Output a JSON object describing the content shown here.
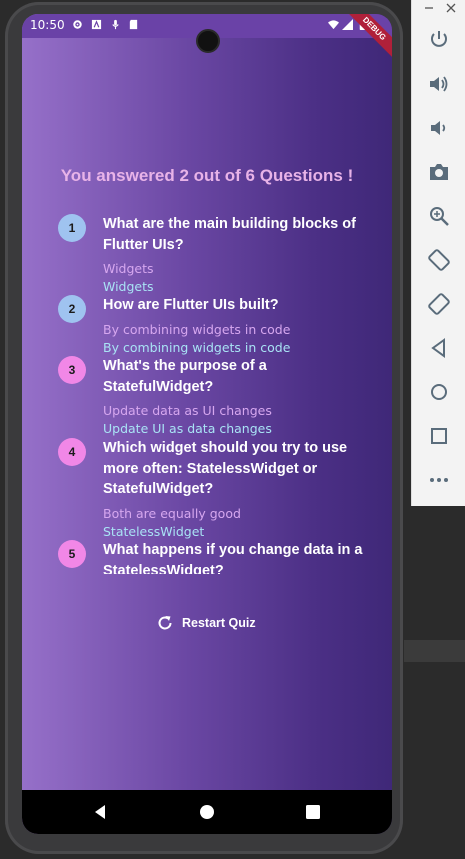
{
  "status_bar": {
    "time": "10:50",
    "debug_banner": "DEBUG"
  },
  "quiz_summary": {
    "title": "You answered 2 out of 6 Questions !",
    "items": [
      {
        "number": "1",
        "question": "What are the main building blocks of Flutter UIs?",
        "user_answer": "Widgets",
        "correct_answer": "Widgets",
        "is_correct": true
      },
      {
        "number": "2",
        "question": "How are Flutter UIs built?",
        "user_answer": "By combining widgets in code",
        "correct_answer": "By combining widgets in code",
        "is_correct": true
      },
      {
        "number": "3",
        "question": "What's the purpose of a StatefulWidget?",
        "user_answer": "Update data as UI changes",
        "correct_answer": "Update UI as data changes",
        "is_correct": false
      },
      {
        "number": "4",
        "question": "Which widget should you try to use more often: StatelessWidget or StatefulWidget?",
        "user_answer": "Both are equally good",
        "correct_answer": "StatelessWidget",
        "is_correct": false
      },
      {
        "number": "5",
        "question": "What happens if you change data in a StatelessWidget?",
        "user_answer": "",
        "correct_answer": "",
        "is_correct": false
      }
    ],
    "restart_label": "Restart Quiz"
  },
  "colors": {
    "correct_badge": "#9fc3f0",
    "wrong_badge": "#f187e7",
    "title": "#e8b3e8",
    "user_answer": "#d6a7ef",
    "correct_answer": "#a9e3f5"
  },
  "toolbar": {
    "buttons": [
      "power-icon",
      "volume-up-icon",
      "volume-down-icon",
      "camera-icon",
      "zoom-icon",
      "rotate-left-icon",
      "rotate-right-icon",
      "back-icon",
      "home-icon",
      "overview-icon",
      "more-icon"
    ]
  }
}
